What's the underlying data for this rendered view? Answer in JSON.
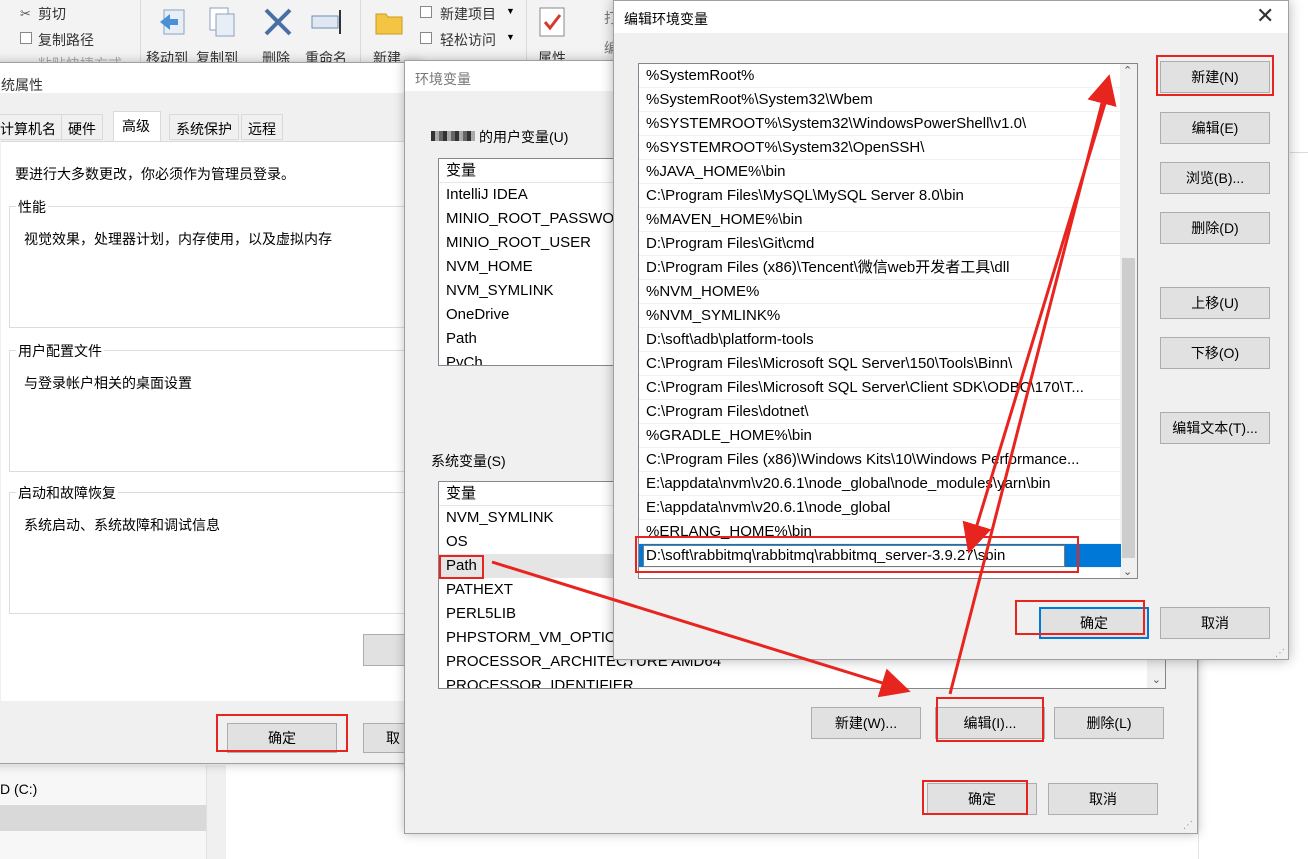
{
  "explorer": {
    "cut_label": "剪切",
    "copy_path_label": "复制路径",
    "paste_shortcut_label": "粘贴快捷方式",
    "move_to_label": "移动到",
    "copy_to_label": "复制到",
    "delete_label": "删除",
    "rename_label": "重命名",
    "new_label": "新建",
    "new_item_label": "新建项目",
    "easy_access_label": "轻松访问",
    "properties_label": "属性",
    "open_label": "打",
    "edit_label": "编",
    "drive_label": "D (C:)"
  },
  "system_properties": {
    "title": "统属性",
    "tabs": [
      "计算机名",
      "硬件",
      "高级",
      "系统保护",
      "远程"
    ],
    "admin_note": "要进行大多数更改，你必须作为管理员登录。",
    "performance_title": "性能",
    "performance_desc": "视觉效果，处理器计划，内存使用，以及虚拟内存",
    "profile_title": "用户配置文件",
    "profile_desc": "与登录帐户相关的桌面设置",
    "startup_title": "启动和故障恢复",
    "startup_desc": "系统启动、系统故障和调试信息",
    "ok_label": "确定",
    "cancel_label": "取"
  },
  "env_vars": {
    "title": "环境变量",
    "user_vars_label": "的用户变量(U)",
    "user_list_header": "变量",
    "user_vars": [
      "IntelliJ IDEA",
      "MINIO_ROOT_PASSWO",
      "MINIO_ROOT_USER",
      "NVM_HOME",
      "NVM_SYMLINK",
      "OneDrive",
      "Path",
      "PyCh"
    ],
    "sys_vars_label": "系统变量(S)",
    "sys_list_header": "变量",
    "sys_vars": [
      "NVM_SYMLINK",
      "OS",
      "Path",
      "PATHEXT",
      "PERL5LIB",
      "PHPSTORM_VM_OPTIO",
      "PROCESSOR_ARCHITECTURE  AMD64",
      "PROCESSOR_IDENTIFIER"
    ],
    "new_label": "新建(W)...",
    "edit_label": "编辑(I)...",
    "delete_label": "删除(L)",
    "ok_label": "确定",
    "cancel_label": "取消"
  },
  "edit_env": {
    "title": "编辑环境变量",
    "paths": [
      "%SystemRoot%",
      "%SystemRoot%\\System32\\Wbem",
      "%SYSTEMROOT%\\System32\\WindowsPowerShell\\v1.0\\",
      "%SYSTEMROOT%\\System32\\OpenSSH\\",
      "%JAVA_HOME%\\bin",
      "C:\\Program Files\\MySQL\\MySQL Server 8.0\\bin",
      "%MAVEN_HOME%\\bin",
      "D:\\Program Files\\Git\\cmd",
      "D:\\Program Files (x86)\\Tencent\\微信web开发者工具\\dll",
      "%NVM_HOME%",
      "%NVM_SYMLINK%",
      "D:\\soft\\adb\\platform-tools",
      "C:\\Program Files\\Microsoft SQL Server\\150\\Tools\\Binn\\",
      "C:\\Program Files\\Microsoft SQL Server\\Client SDK\\ODBC\\170\\T...",
      "C:\\Program Files\\dotnet\\",
      "%GRADLE_HOME%\\bin",
      "C:\\Program Files (x86)\\Windows Kits\\10\\Windows Performance...",
      "E:\\appdata\\nvm\\v20.6.1\\node_global\\node_modules\\yarn\\bin",
      "E:\\appdata\\nvm\\v20.6.1\\node_global",
      "%ERLANG_HOME%\\bin"
    ],
    "editing_value": "D:\\soft\\rabbitmq\\rabbitmq\\rabbitmq_server-3.9.27\\sbin",
    "new_label": "新建(N)",
    "edit_label": "编辑(E)",
    "browse_label": "浏览(B)...",
    "delete_label": "删除(D)",
    "move_up_label": "上移(U)",
    "move_down_label": "下移(O)",
    "edit_text_label": "编辑文本(T)...",
    "ok_label": "确定",
    "cancel_label": "取消"
  },
  "colors": {
    "annotation": "#e8241f",
    "selection": "#0078d7"
  }
}
